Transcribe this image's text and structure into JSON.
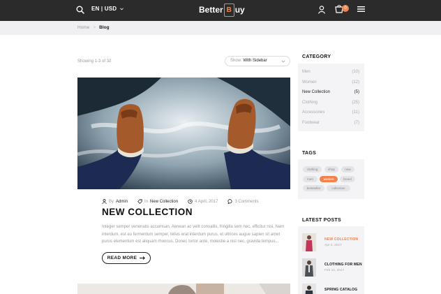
{
  "header": {
    "lang_currency": "EN | USD",
    "logo_left": "Better",
    "logo_bag_letter": "B",
    "logo_right": "uy",
    "cart_count": "0",
    "icons": [
      "search-icon",
      "user-icon",
      "cart-icon",
      "menu-icon"
    ]
  },
  "breadcrumb": {
    "home": "Home",
    "separator": ">",
    "current": "Blog"
  },
  "toolbar": {
    "showing": "Showing 1-3 of 32",
    "show_label": "Show:",
    "show_value": "With Sidebar"
  },
  "post": {
    "by_label": "By",
    "author": "Admin",
    "in_label": "In",
    "category": "New Collection",
    "date": "4 April, 2017",
    "comments": "3 Comments",
    "title": "NEW COLLECTION",
    "excerpt": "Integer semper venenatis accumsan. Aenean ac velit convallis, fringilla sem nec, efficitur nisi. Nam interdum, est eu fermentum semper, tellus erat interdum purus, et ultrices augue sapien sit amet purus elementum est aliquam rhoncus. Donec tortor ante, molestie a nisl nec, gravida tempus...",
    "read_more": "READ MORE"
  },
  "sidebar": {
    "category_title": "CATEGORY",
    "categories": [
      {
        "name": "Men",
        "count": "(10)"
      },
      {
        "name": "Women",
        "count": "(12)"
      },
      {
        "name": "New Collection",
        "count": "(5)"
      },
      {
        "name": "Clothing",
        "count": "(25)"
      },
      {
        "name": "Accessories",
        "count": "(11)"
      },
      {
        "name": "Footwear",
        "count": "(7)"
      }
    ],
    "tags_title": "TAGS",
    "tags": [
      "clothing",
      "shop",
      "new",
      "men",
      "women",
      "brand",
      "bestseller",
      "collection"
    ],
    "latest_title": "LATEST POSTS",
    "latest": [
      {
        "title": "NEW COLLECTION",
        "date": "Apr 4, 2017"
      },
      {
        "title": "CLOTHING FOR MEN",
        "date": "Feb 12, 2017"
      },
      {
        "title": "SPRING CATALOG",
        "date": ""
      }
    ]
  },
  "colors": {
    "accent": "#f0844f",
    "topbar": "#2b2b2b",
    "panel": "#f4f4f6"
  }
}
